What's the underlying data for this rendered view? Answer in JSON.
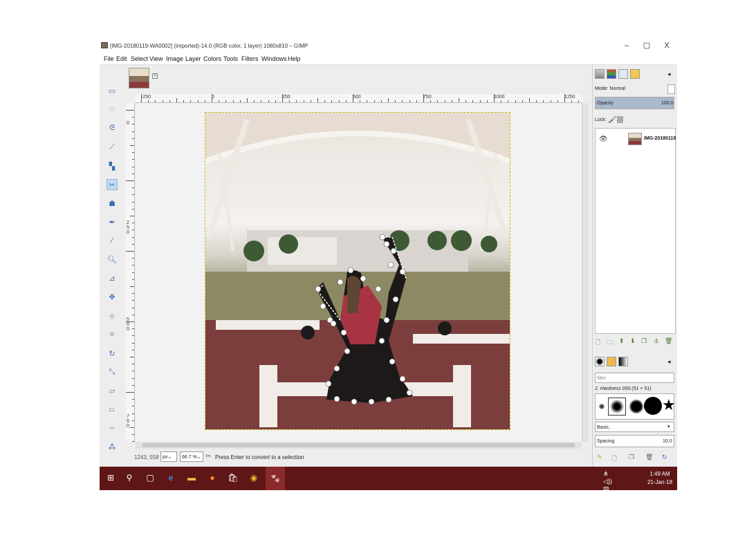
{
  "window": {
    "title": "[IMG-20180119-WA0002] (imported)-14.0 (RGB color, 1 layer) 1080x810 – GIMP",
    "controls": {
      "minimize": "–",
      "maximize": "▢",
      "close": "X"
    }
  },
  "menu": [
    "File",
    "Edit",
    "Select",
    "View",
    "Image",
    "Layer",
    "Colors",
    "Tools",
    "Filters",
    "Windows",
    "Help"
  ],
  "image_tab": {
    "close": "×"
  },
  "ruler": {
    "h_labels": [
      "-250",
      "0",
      "250",
      "500",
      "750",
      "1000",
      "1250"
    ],
    "v_labels": [
      "0",
      "250",
      "500",
      "750"
    ]
  },
  "status": {
    "coords": "1243, 558",
    "unit": "px",
    "zoom": "66.7 %",
    "message": "Press Enter to convert to a selection"
  },
  "layers_panel": {
    "mode_label": "Mode: Normal",
    "opacity_label": "Opacity",
    "opacity_value": "100.0",
    "lock_label": "Lock:",
    "layer_name": "IMG-20180119"
  },
  "brushes_panel": {
    "filter_placeholder": "filter",
    "brush_name": "2. Hardness 050 (51 × 51)",
    "preset": "Basic,",
    "spacing_label": "Spacing",
    "spacing_value": "10.0"
  },
  "taskbar": {
    "time": "1:49 AM",
    "date": "21-Jan-18"
  },
  "tools": [
    "rect-select",
    "ellipse-select",
    "free-select",
    "fuzzy-select",
    "select-by-color",
    "scissors-select",
    "foreground-select",
    "paths",
    "color-picker",
    "zoom",
    "measure",
    "move",
    "align",
    "crop",
    "rotate",
    "scale",
    "shear",
    "perspective",
    "flip",
    "cage",
    "warp"
  ]
}
